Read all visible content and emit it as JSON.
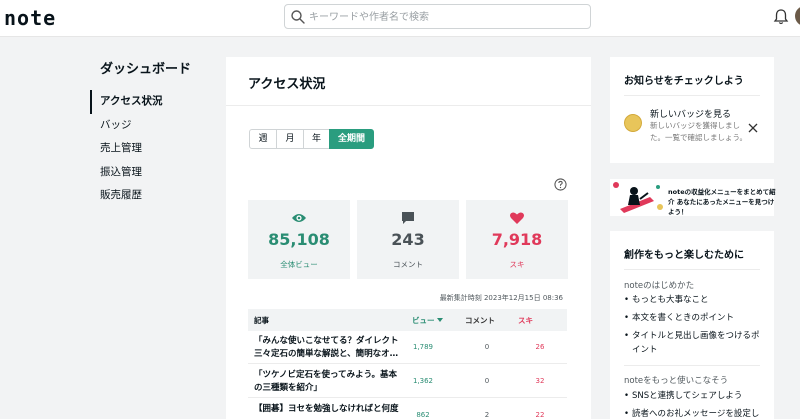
{
  "header": {
    "logo": "note",
    "search_placeholder": "キーワードや作者名で検索"
  },
  "sidebar": {
    "title": "ダッシュボード",
    "items": [
      {
        "label": "アクセス状況"
      },
      {
        "label": "バッジ"
      },
      {
        "label": "売上管理"
      },
      {
        "label": "振込管理"
      },
      {
        "label": "販売履歴"
      }
    ]
  },
  "main": {
    "title": "アクセス状況",
    "tabs": [
      "週",
      "月",
      "年",
      "全期間"
    ],
    "active_tab": "全期間",
    "stats": [
      {
        "value": "85,108",
        "label": "全体ビュー"
      },
      {
        "value": "243",
        "label": "コメント"
      },
      {
        "value": "7,918",
        "label": "スキ"
      }
    ],
    "updated": "最新集計時刻 2023年12月15日 08:36",
    "table": {
      "headers": {
        "title": "記事",
        "views": "ビュー",
        "comments": "コメント",
        "likes": "スキ"
      },
      "rows": [
        {
          "title": "「みんな使いこなせてる？ダイレクト三々定石の簡単な解説と、簡明なオ…",
          "views": "1,789",
          "comments": "0",
          "likes": "26"
        },
        {
          "title": "「ツケノビ定石を使ってみよう。基本の三種類を紹介」",
          "views": "1,362",
          "comments": "0",
          "likes": "32"
        },
        {
          "title": "【囲碁】ヨセを勉強しなければと何度",
          "views": "862",
          "comments": "2",
          "likes": "22"
        }
      ]
    }
  },
  "notice": {
    "title": "お知らせをチェックしよう",
    "item_title": "新しいバッジを見る",
    "item_text": "新しいバッジを獲得しました。一覧で確認しましょう。"
  },
  "banner": {
    "text": "noteの収益化メニューをまとめて紹介 あなたにあったメニューを見つけよう！"
  },
  "fun": {
    "title": "創作をもっと楽しむために",
    "section1": "noteのはじめかた",
    "links1": [
      "もっとも大事なこと",
      "本文を書くときのポイント",
      "タイトルと見出し画像をつけるポイント"
    ],
    "section2": "noteをもっと使いこなそう",
    "links2": [
      "SNSと連携してシェアしよう",
      "読者へのお礼メッセージを設定し"
    ]
  },
  "colors": {
    "accent": "#2a9d7f",
    "like": "#e0395a"
  }
}
